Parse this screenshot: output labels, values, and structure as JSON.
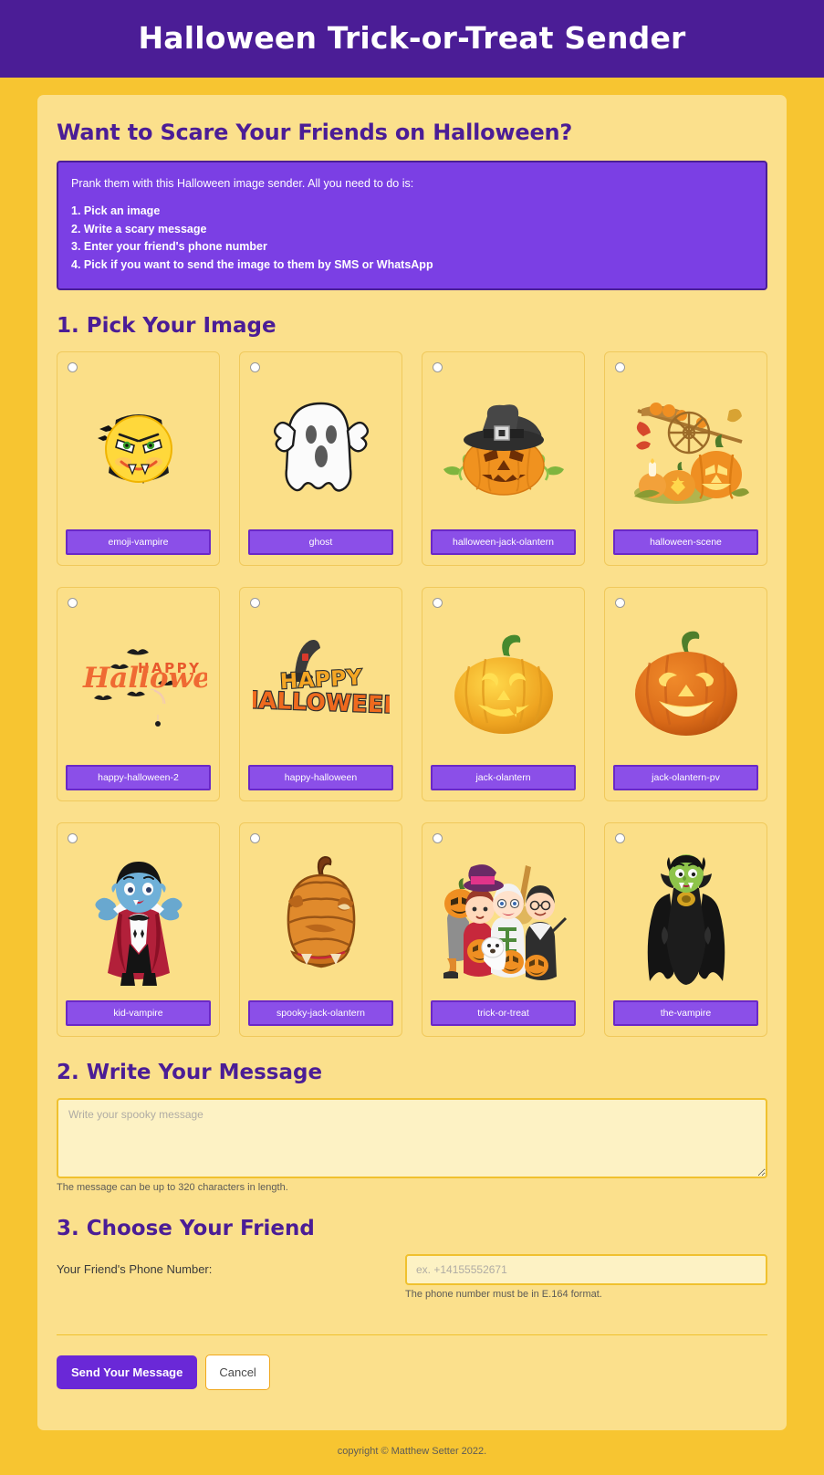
{
  "header": {
    "title": "Halloween Trick-or-Treat Sender"
  },
  "intro": {
    "heading": "Want to Scare Your Friends on Halloween?",
    "lead": "Prank them with this Halloween image sender. All you need to do is:",
    "steps": [
      "1. Pick an image",
      "2. Write a scary message",
      "3. Enter your friend's phone number",
      "4. Pick if you want to send the image to them by SMS or WhatsApp"
    ]
  },
  "step1": {
    "title": "1. Pick Your Image",
    "images": [
      {
        "label": "emoji-vampire",
        "art": "emoji-vampire"
      },
      {
        "label": "ghost",
        "art": "ghost"
      },
      {
        "label": "halloween-jack-olantern",
        "art": "witch-hat-pumpkin"
      },
      {
        "label": "halloween-scene",
        "art": "harvest-scene"
      },
      {
        "label": "happy-halloween-2",
        "art": "script-happy-halloween"
      },
      {
        "label": "happy-halloween",
        "art": "block-happy-halloween"
      },
      {
        "label": "jack-olantern",
        "art": "yellow-pumpkin"
      },
      {
        "label": "jack-olantern-pv",
        "art": "orange-pumpkin"
      },
      {
        "label": "kid-vampire",
        "art": "kid-vampire"
      },
      {
        "label": "spooky-jack-olantern",
        "art": "spooky-pumpkin"
      },
      {
        "label": "trick-or-treat",
        "art": "kids-group"
      },
      {
        "label": "the-vampire",
        "art": "tall-vampire"
      }
    ]
  },
  "step2": {
    "title": "2. Write Your Message",
    "message_value": "",
    "message_placeholder": "Write your spooky message",
    "help": "The message can be up to 320 characters in length."
  },
  "step3": {
    "title": "3. Choose Your Friend",
    "phone_label": "Your Friend's Phone Number:",
    "phone_value": "",
    "phone_placeholder": "ex. +14155552671",
    "phone_help": "The phone number must be in E.164 format."
  },
  "actions": {
    "submit": "Send Your Message",
    "cancel": "Cancel"
  },
  "footer": {
    "copyright": "copyright © Matthew Setter 2022."
  },
  "colors": {
    "header_purple": "#4b1d96",
    "info_purple": "#7b3fe4",
    "label_purple": "#8b4fe8",
    "page_gold": "#f7c531",
    "panel_yellow": "#fbe08c",
    "field_cream": "#fdf2c4"
  }
}
